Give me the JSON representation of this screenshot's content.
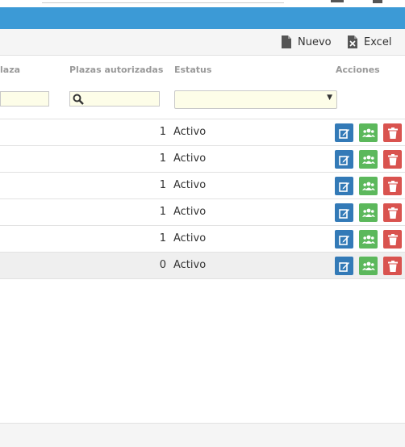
{
  "toolbar": {
    "new_label": "Nuevo",
    "excel_label": "Excel"
  },
  "table": {
    "columns": [
      "laza",
      "Plazas autorizadas",
      "Estatus",
      "Acciones"
    ],
    "rows": [
      {
        "plazas": "1",
        "estatus": "Activo"
      },
      {
        "plazas": "1",
        "estatus": "Activo"
      },
      {
        "plazas": "1",
        "estatus": "Activo"
      },
      {
        "plazas": "1",
        "estatus": "Activo"
      },
      {
        "plazas": "1",
        "estatus": "Activo"
      },
      {
        "plazas": "0",
        "estatus": "Activo"
      }
    ],
    "highlighted_row": 5
  },
  "icons": {
    "new": "file-icon",
    "excel": "excel-file-icon",
    "search": "search-icon",
    "edit": "edit-icon",
    "group": "users-icon",
    "delete": "trash-icon",
    "dropdown": "caret-down-icon"
  },
  "colors": {
    "header_bar": "#3c9ad6",
    "edit_button": "#337ab7",
    "group_button": "#5cb85c",
    "delete_button": "#d9534f",
    "filter_background": "#fdfde8"
  }
}
